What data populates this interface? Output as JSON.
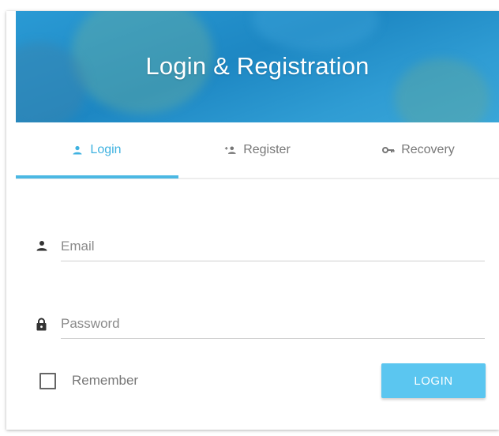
{
  "header": {
    "title": "Login & Registration"
  },
  "tabs": [
    {
      "label": "Login",
      "icon": "person-icon",
      "active": true
    },
    {
      "label": "Register",
      "icon": "person-add-icon",
      "active": false
    },
    {
      "label": "Recovery",
      "icon": "key-icon",
      "active": false
    }
  ],
  "form": {
    "email": {
      "placeholder": "Email",
      "value": "",
      "icon": "person-icon"
    },
    "password": {
      "placeholder": "Password",
      "value": "",
      "icon": "lock-icon"
    },
    "remember": {
      "label": "Remember",
      "checked": false
    },
    "submit_label": "LOGIN"
  },
  "colors": {
    "header_blue": "#1d87c3",
    "accent": "#4bb8e3",
    "button": "#5bc6f0"
  }
}
